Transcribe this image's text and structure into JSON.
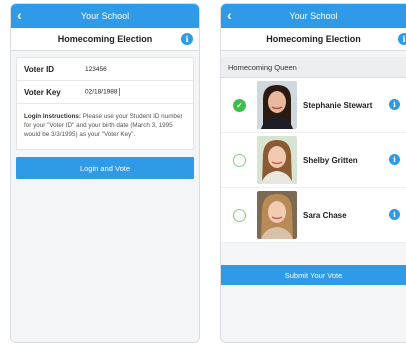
{
  "left_screen": {
    "app_title": "Your School",
    "page_title": "Homecoming Election",
    "fields": [
      {
        "label": "Voter ID",
        "value": "123456"
      },
      {
        "label": "Voter Key",
        "value": "02/18/1988"
      }
    ],
    "instructions_title": "Login Instructions:",
    "instructions_text": " Please use your Student ID number for your \"Voter ID\" and your birth date (March 3, 1995 would be 3/3/1995) as your \"Voter Key\".",
    "login_button": "Login and Vote"
  },
  "right_screen": {
    "app_title": "Your School",
    "page_title": "Homecoming Election",
    "section_title": "Homecoming Queen",
    "candidates": [
      {
        "name": "Stephanie Stewart",
        "selected": true
      },
      {
        "name": "Shelby Gritten",
        "selected": false
      },
      {
        "name": "Sara Chase",
        "selected": false
      }
    ],
    "submit_button": "Submit Your Vote"
  },
  "icons": {
    "back": "chevron-left-icon",
    "info": "info-icon",
    "check": "checkmark-icon"
  },
  "colors": {
    "accent": "#2f9be8",
    "selected": "#3cbf4a",
    "unselected_ring": "#7fd17b"
  }
}
